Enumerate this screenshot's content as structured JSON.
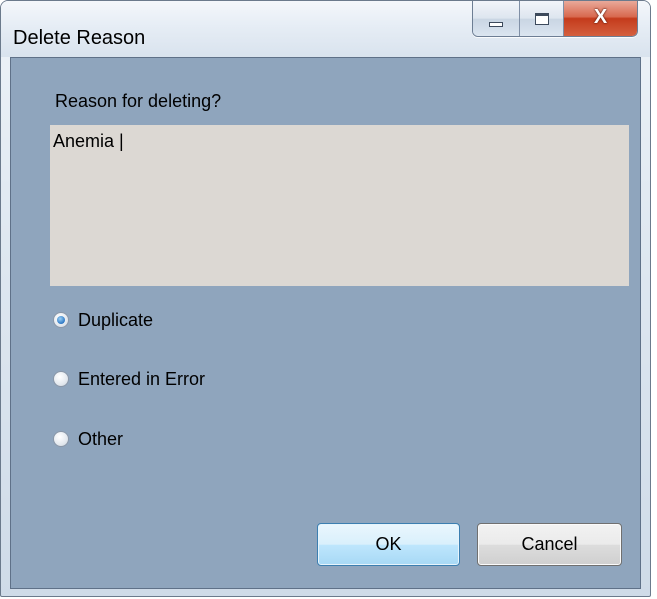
{
  "window": {
    "title": "Delete Reason",
    "close_glyph": "X",
    "icons": {
      "minimize": "minimize-icon",
      "maximize": "maximize-icon",
      "close": "close-icon"
    }
  },
  "form": {
    "prompt": "Reason for deleting?",
    "reason_text": "Anemia |",
    "options": [
      {
        "label": "Duplicate",
        "selected": true
      },
      {
        "label": "Entered in Error",
        "selected": false
      },
      {
        "label": "Other",
        "selected": false
      }
    ]
  },
  "buttons": {
    "ok_label": "OK",
    "cancel_label": "Cancel"
  },
  "colors": {
    "client_background": "#8fa5bd",
    "textbox_background": "#dcd8d3",
    "ok_focus_border": "#3c7fb1",
    "close_button_red": "#c43b1c"
  }
}
